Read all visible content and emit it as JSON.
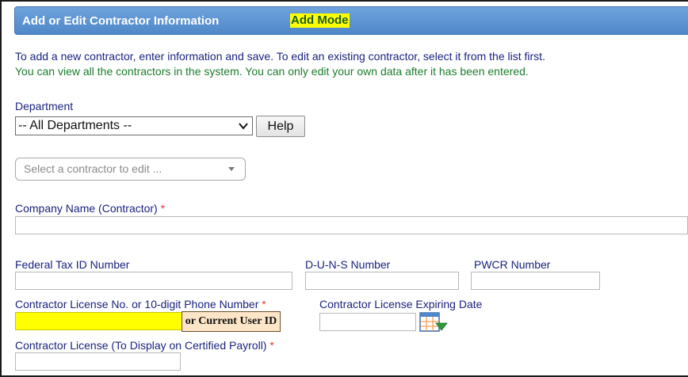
{
  "header": {
    "title": "Add or Edit Contractor Information",
    "mode": "Add Mode"
  },
  "instructions": {
    "line1": "To add a new contractor, enter information and save. To edit an existing contractor, select it from the list first.",
    "line2": "You can view all the contractors in the system. You can only edit your own data after it has been entered."
  },
  "department": {
    "label": "Department",
    "selected": "-- All Departments --",
    "help_label": "Help"
  },
  "contractor_picker": {
    "placeholder": "Select a contractor to edit ..."
  },
  "fields": {
    "company_name": {
      "label": "Company Name (Contractor)",
      "required": "*",
      "value": ""
    },
    "federal_tax_id": {
      "label": "Federal Tax ID Number",
      "value": ""
    },
    "duns": {
      "label": "D-U-N-S Number",
      "value": ""
    },
    "pwcr": {
      "label": "PWCR Number",
      "value": ""
    },
    "license_or_phone": {
      "label": "Contractor License No. or 10-digit Phone Number",
      "required": "*",
      "value": "",
      "tooltip": "or Current User ID"
    },
    "license_expiring": {
      "label": "Contractor License Expiring Date",
      "value": ""
    },
    "license_display": {
      "label": "Contractor License (To Display on Certified Payroll)",
      "required": "*",
      "value": ""
    }
  },
  "icons": {
    "calendar": "calendar-icon",
    "dropdown": "chevron-down-icon"
  },
  "colors": {
    "header_bg": "#5b93d3",
    "mode_highlight": "#ffff00",
    "label_text": "#1a237e",
    "instruction_green": "#1b7d2c",
    "required": "#e53935",
    "highlight_field": "#ffff00",
    "tooltip_bg": "#fde5c8"
  }
}
